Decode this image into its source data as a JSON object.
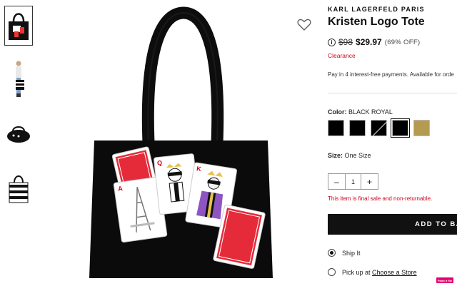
{
  "product": {
    "brand": "KARL LAGERFELD PARIS",
    "title": "Kristen Logo Tote",
    "original_price": "$98",
    "sale_price": "$29.97",
    "discount": "(69% OFF)",
    "clearance": "Clearance",
    "payments_text": "Pay in 4 interest-free payments. Available for orde"
  },
  "color": {
    "label": "Color:",
    "selected": "BLACK ROYAL",
    "swatch_colors": [
      "#000000",
      "#000000",
      "#000000",
      "#000000",
      "#b59a52"
    ]
  },
  "size": {
    "label": "Size:",
    "value": "One Size"
  },
  "quantity": {
    "minus": "–",
    "value": "1",
    "plus": "+"
  },
  "notice": "This item is final sale and non-returnable.",
  "add_to_bag": "ADD TO BAG",
  "fulfillment": {
    "ship": "Ship It",
    "pickup_prefix": "Pick up at",
    "pickup_link": "Choose a Store"
  },
  "badge": "Paint it file",
  "icons": {
    "wishlist": "heart-icon",
    "info": "info-icon"
  },
  "accent_colors": {
    "sale_red": "#d0021b",
    "button_bg": "#111111"
  }
}
